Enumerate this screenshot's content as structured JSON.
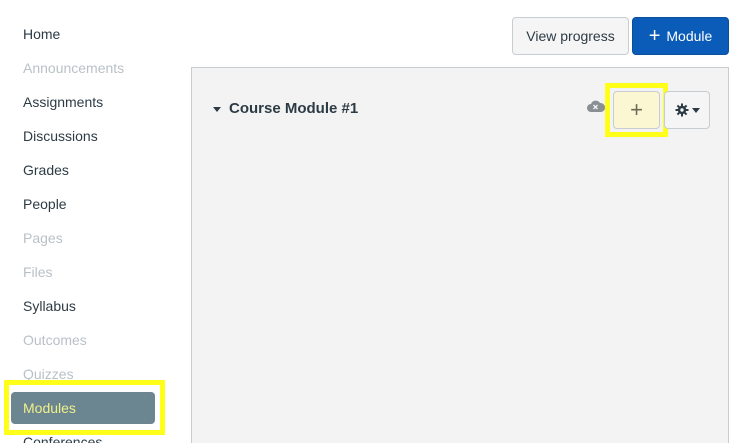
{
  "nav": {
    "items": [
      {
        "label": "Home",
        "state": "enabled"
      },
      {
        "label": "Announcements",
        "state": "disabled"
      },
      {
        "label": "Assignments",
        "state": "enabled"
      },
      {
        "label": "Discussions",
        "state": "enabled"
      },
      {
        "label": "Grades",
        "state": "enabled"
      },
      {
        "label": "People",
        "state": "enabled"
      },
      {
        "label": "Pages",
        "state": "disabled"
      },
      {
        "label": "Files",
        "state": "disabled"
      },
      {
        "label": "Syllabus",
        "state": "enabled"
      },
      {
        "label": "Outcomes",
        "state": "disabled"
      },
      {
        "label": "Quizzes",
        "state": "disabled"
      },
      {
        "label": "Modules",
        "state": "active"
      },
      {
        "label": "Conferences",
        "state": "enabled"
      }
    ]
  },
  "header": {
    "view_progress_label": "View progress",
    "add_module_label": "Module",
    "add_module_icon": "plus-icon"
  },
  "module": {
    "title": "Course Module #1",
    "status_icon": "unpublished-cloud-icon",
    "add_item_icon": "plus-icon",
    "settings_icon": "gear-icon"
  },
  "colors": {
    "primary": "#0b5bb8",
    "highlight": "#ffff1a",
    "active_nav": "#6b8691",
    "disabled_text": "#b9c1c7"
  }
}
